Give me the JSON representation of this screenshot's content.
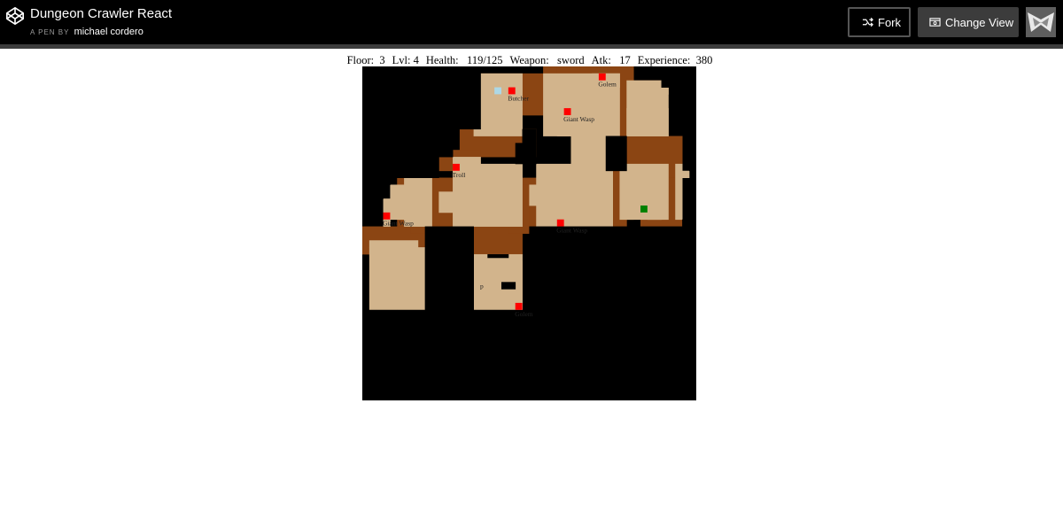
{
  "header": {
    "title": "Dungeon Crawler React",
    "byline_prefix": "A PEN BY",
    "author": "michael cordero",
    "fork_label": "Fork",
    "change_view_label": "Change View"
  },
  "stats": {
    "floor_label": "Floor:",
    "floor": "3",
    "lvl_label": "Lvl:",
    "lvl": "4",
    "health_label": "Health:",
    "health": "119/125",
    "weapon_label": "Weapon:",
    "weapon": "sword",
    "atk_label": "Atk:",
    "atk": "17",
    "experience_label": "Experience:",
    "experience": "380"
  },
  "colors": {
    "background": "#000000",
    "floor": "#d2b48c",
    "wall": "#8b4513",
    "enemy": "#ff0000",
    "player": "#008000",
    "item": "#add8e6"
  },
  "map": {
    "entities": [
      {
        "kind": "item",
        "label": "",
        "row": 3,
        "col": 19
      },
      {
        "kind": "enemy",
        "label": "Butcher",
        "row": 3,
        "col": 21
      },
      {
        "kind": "enemy",
        "label": "Golem",
        "row": 1,
        "col": 34
      },
      {
        "kind": "enemy",
        "label": "Giant Wasp",
        "row": 6,
        "col": 29
      },
      {
        "kind": "enemy",
        "label": "Troll",
        "row": 14,
        "col": 13
      },
      {
        "kind": "enemy",
        "label": "Giant Wasp",
        "row": 21,
        "col": 3
      },
      {
        "kind": "enemy",
        "label": "Giant Wasp",
        "row": 22,
        "col": 28
      },
      {
        "kind": "player",
        "label": "",
        "row": 20,
        "col": 40
      },
      {
        "kind": "enemy",
        "label": "Golem",
        "row": 34,
        "col": 22
      },
      {
        "kind": "enemy_label_only",
        "label": "p",
        "row": 30,
        "col": 17
      }
    ]
  }
}
